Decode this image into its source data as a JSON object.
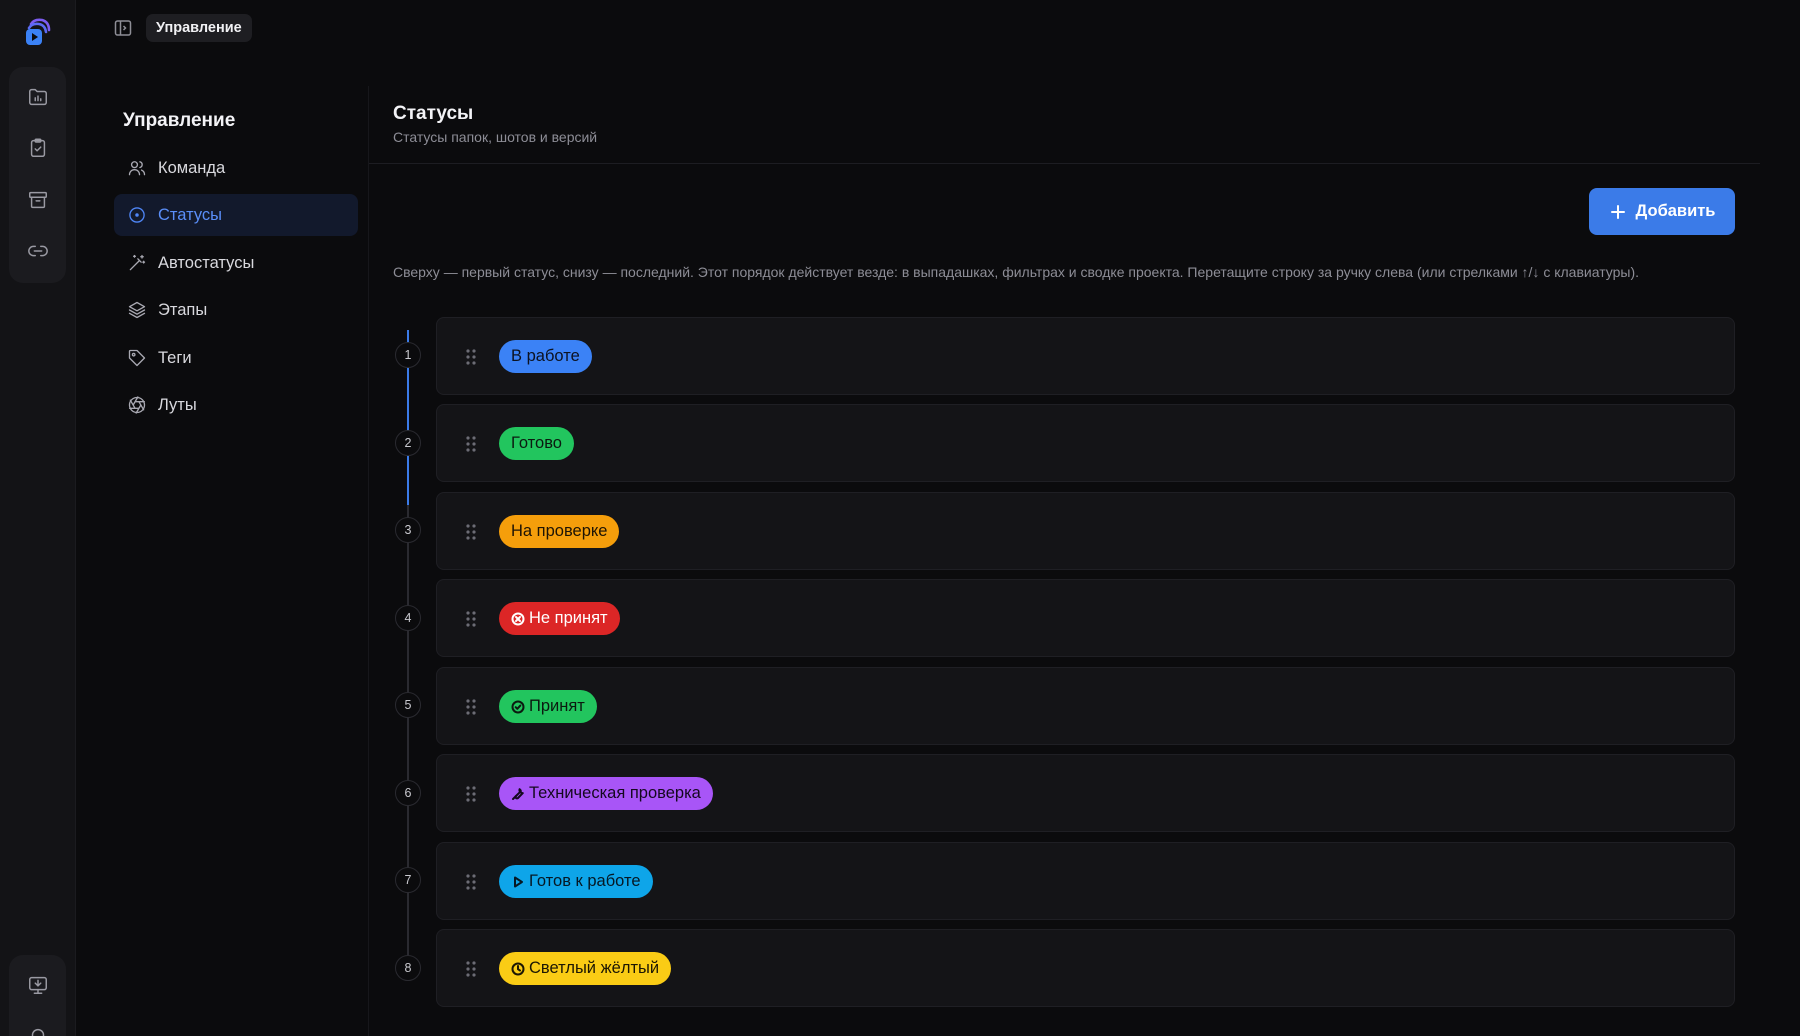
{
  "breadcrumb": "Управление",
  "nav": {
    "title": "Управление",
    "items": [
      {
        "label": "Команда",
        "icon": "users-icon",
        "active": false
      },
      {
        "label": "Статусы",
        "icon": "circle-dot-icon",
        "active": true
      },
      {
        "label": "Автостатусы",
        "icon": "magic-wand-icon",
        "active": false
      },
      {
        "label": "Этапы",
        "icon": "layers-icon",
        "active": false
      },
      {
        "label": "Теги",
        "icon": "tag-icon",
        "active": false
      },
      {
        "label": "Луты",
        "icon": "aperture-icon",
        "active": false
      }
    ]
  },
  "rail": {
    "icons": [
      "folder-chart-icon",
      "clipboard-check-icon",
      "archive-icon",
      "link-icon",
      "monitor-download-icon",
      "bell-icon"
    ]
  },
  "main": {
    "title": "Статусы",
    "subtitle": "Статусы папок, шотов и версий",
    "add_label": "Добавить",
    "hint": "Сверху — первый статус, снизу — последний. Этот порядок действует везде: в выпадашках, фильтрах и сводке проекта. Перетащите строку за ручку слева (или стрелками ↑/↓ с клавиатуры)."
  },
  "statuses": [
    {
      "num": "1",
      "label": "В работе",
      "color": "#3b82f6",
      "text": "#0c1220",
      "icon": ""
    },
    {
      "num": "2",
      "label": "Готово",
      "color": "#22c55e",
      "text": "#0b1a10",
      "icon": ""
    },
    {
      "num": "3",
      "label": "На проверке",
      "color": "#f59e0b",
      "text": "#1e1405",
      "icon": ""
    },
    {
      "num": "4",
      "label": "Не принят",
      "color": "#dc2626",
      "text": "#ffffff",
      "icon": "x-circle-icon"
    },
    {
      "num": "5",
      "label": "Принят",
      "color": "#22c55e",
      "text": "#0b1a10",
      "icon": "check-circle-icon"
    },
    {
      "num": "6",
      "label": "Техническая проверка",
      "color": "#a855f7",
      "text": "#14081f",
      "icon": "wrench-icon"
    },
    {
      "num": "7",
      "label": "Готов к работе",
      "color": "#0ea5e9",
      "text": "#061824",
      "icon": "play-icon"
    },
    {
      "num": "8",
      "label": "Светлый жёлтый",
      "color": "#facc15",
      "text": "#1c1704",
      "icon": "clock-icon"
    }
  ]
}
